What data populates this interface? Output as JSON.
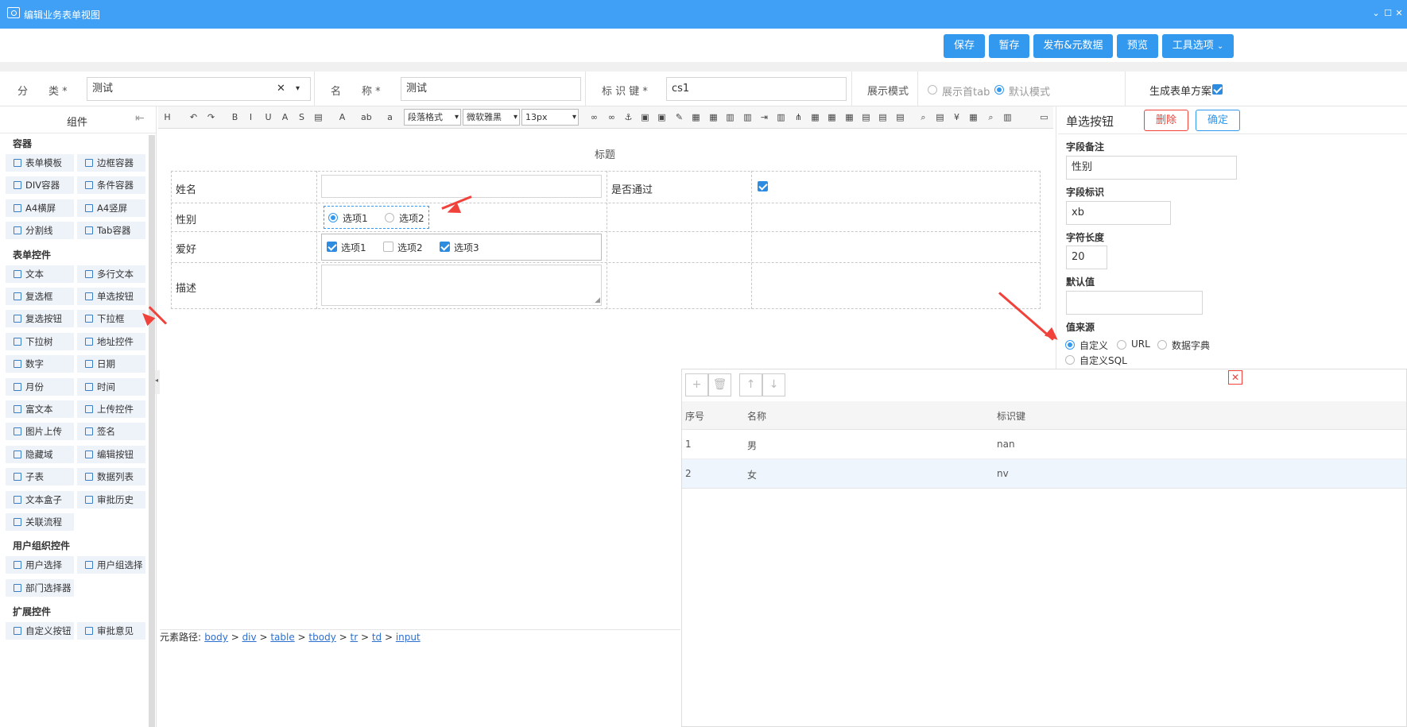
{
  "window": {
    "title": "编辑业务表单视图"
  },
  "toolbar": {
    "save": "保存",
    "draft": "暂存",
    "publish": "发布&元数据",
    "preview": "预览",
    "tools": "工具选项"
  },
  "form_header": {
    "category_label": "分　　类 *",
    "category_value": "测试",
    "name_label": "名　　称 *",
    "name_value": "测试",
    "key_label": "标 识 键 *",
    "key_value": "cs1",
    "display_mode_label": "展示模式",
    "display_mode_options": [
      "展示首tab",
      "默认模式"
    ],
    "display_mode_selected": "默认模式",
    "gen_plan_label": "生成表单方案",
    "gen_plan_checked": true
  },
  "components_panel": {
    "title": "组件",
    "sections": [
      {
        "title": "容器",
        "items": [
          "表单模板",
          "边框容器",
          "DIV容器",
          "条件容器",
          "A4横屏",
          "A4竖屏",
          "分割线",
          "Tab容器"
        ]
      },
      {
        "title": "表单控件",
        "items": [
          "文本",
          "多行文本",
          "复选框",
          "单选按钮",
          "复选按钮",
          "下拉框",
          "下拉树",
          "地址控件",
          "数字",
          "日期",
          "月份",
          "时间",
          "富文本",
          "上传控件",
          "图片上传",
          "签名",
          "隐藏域",
          "编辑按钮",
          "子表",
          "数据列表",
          "文本盒子",
          "审批历史",
          "关联流程"
        ]
      },
      {
        "title": "用户组织控件",
        "items": [
          "用户选择",
          "用户组选择",
          "部门选择器"
        ]
      },
      {
        "title": "扩展控件",
        "items": [
          "自定义按钮",
          "审批意见"
        ]
      }
    ]
  },
  "editor": {
    "toolbar": {
      "paragraph": "段落格式",
      "font": "微软雅黑",
      "size": "13px"
    },
    "form_title": "标题",
    "rows": [
      {
        "label": "姓名",
        "side_label": "是否通过"
      },
      {
        "label": "性别",
        "options": [
          "选项1",
          "选项2"
        ],
        "selected": "选项1"
      },
      {
        "label": "爱好",
        "options": [
          "选项1",
          "选项2",
          "选项3"
        ],
        "checked": [
          "选项1",
          "选项3"
        ]
      },
      {
        "label": "描述"
      }
    ],
    "path_label": "元素路径:",
    "path": [
      "body",
      "div",
      "table",
      "tbody",
      "tr",
      "td",
      "input"
    ]
  },
  "properties": {
    "title": "单选按钮",
    "delete": "删除",
    "confirm": "确定",
    "remark_label": "字段备注",
    "remark_value": "性别",
    "field_key_label": "字段标识",
    "field_key_value": "xb",
    "length_label": "字符长度",
    "length_value": "20",
    "default_label": "默认值",
    "default_value": "",
    "source_label": "值来源",
    "source_options": [
      "自定义",
      "URL",
      "数据字典",
      "自定义SQL"
    ],
    "source_selected": "自定义"
  },
  "options_table": {
    "headers": [
      "序号",
      "名称",
      "标识键"
    ],
    "rows": [
      {
        "index": "1",
        "name": "男",
        "key": "nan"
      },
      {
        "index": "2",
        "name": "女",
        "key": "nv"
      }
    ]
  },
  "colors": {
    "primary": "#3399ee",
    "titlebar": "#3fa0f5",
    "danger": "#f0423a"
  }
}
